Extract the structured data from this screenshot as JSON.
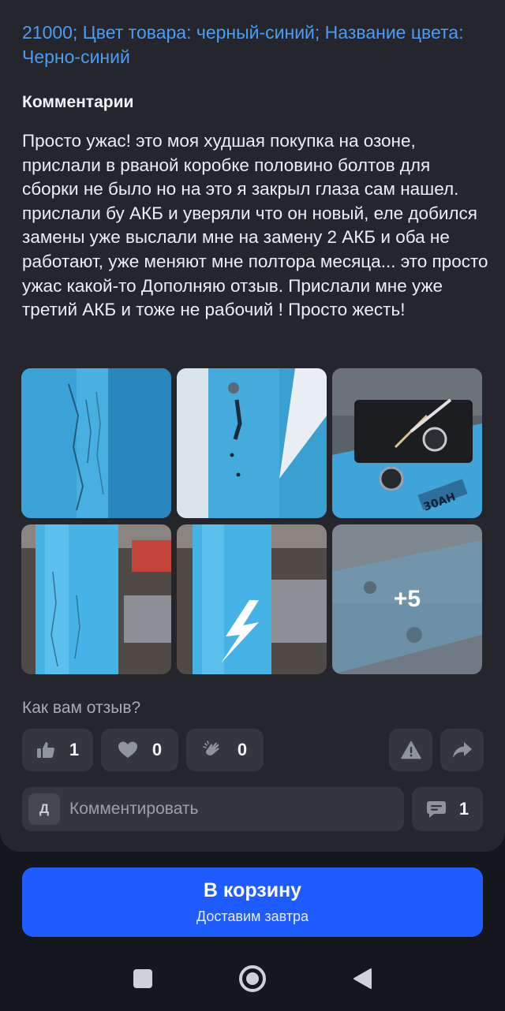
{
  "product": {
    "variant_text": "21000; Цвет товара: черный-синий; Название цвета: Черно-синий"
  },
  "review": {
    "comments_title": "Комментарии",
    "comment_text": "Просто ужас! это моя худшая покупка на озоне, прислали в рваной коробке половино болтов для сборки не было но на это я закрыл глаза сам нашел. прислали бу АКБ и уверяли что он новый, еле добился замены уже выслали мне на замену 2 АКБ и оба не работают, уже меняют мне полтора месяца... это просто ужас какой-то Дополняю отзыв. Прислали мне уже третий АКБ и тоже не рабочий ! Просто жесть!",
    "photos": [
      {
        "name": "photo-1",
        "icon": "blue-frame-scratches"
      },
      {
        "name": "photo-2",
        "icon": "blue-frame-bolt"
      },
      {
        "name": "photo-3",
        "icon": "battery-with-keys",
        "label_text": "30AH"
      },
      {
        "name": "photo-4",
        "icon": "blue-frame-closeup"
      },
      {
        "name": "photo-5",
        "icon": "blue-frame-lightning-logo"
      },
      {
        "name": "photo-6",
        "icon": "blurred-frame"
      }
    ],
    "more_photos_label": "+5"
  },
  "feedback": {
    "question": "Как вам отзыв?",
    "like_count": "1",
    "heart_count": "0",
    "clap_count": "0"
  },
  "comment_box": {
    "avatar_letter": "Д",
    "placeholder": "Комментировать",
    "replies_count": "1"
  },
  "cart": {
    "button_label": "В корзину",
    "button_sublabel": "Доставим завтра"
  },
  "colors": {
    "accent_blue": "#1f5cff",
    "link_blue": "#4a9cf5",
    "card_bg": "#24262c",
    "page_bg": "#16171c"
  },
  "icons": [
    "thumbs-up-icon",
    "heart-icon",
    "clapping-hands-icon",
    "warning-icon",
    "share-icon",
    "chat-bubble-icon",
    "nav-square-icon",
    "nav-circle-icon",
    "nav-back-icon"
  ]
}
